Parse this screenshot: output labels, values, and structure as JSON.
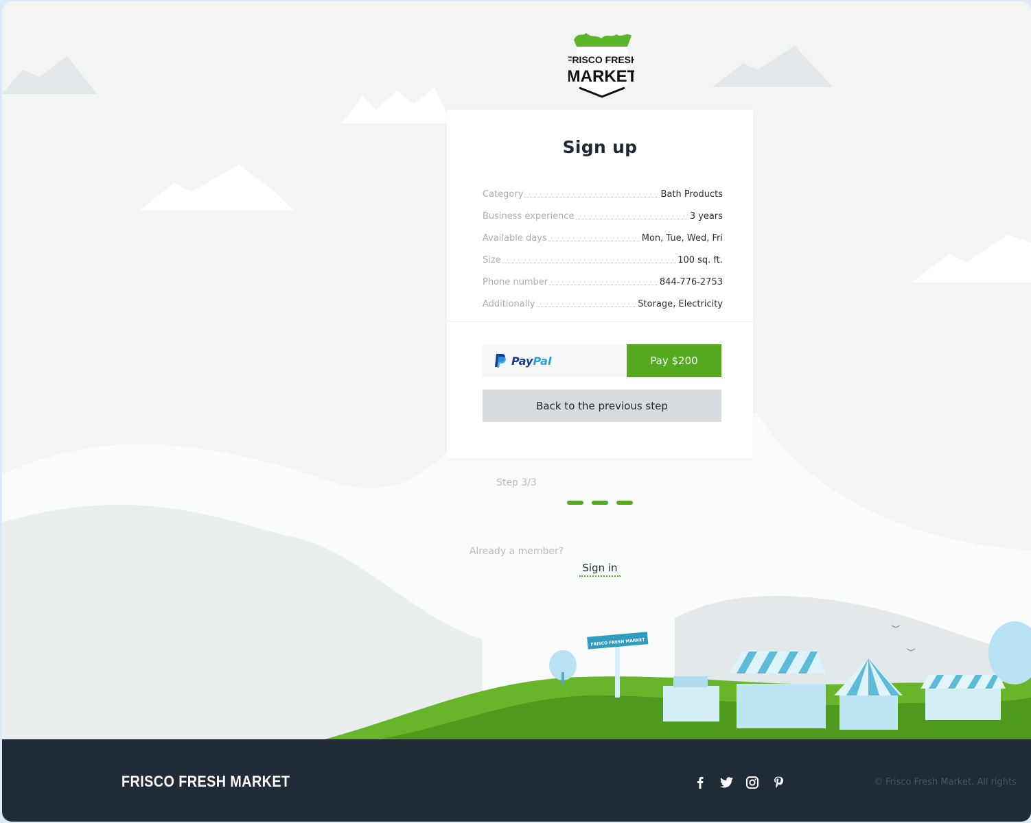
{
  "logo": {
    "line1": "FRISCO FRESH",
    "line2": "MARKET"
  },
  "card": {
    "title": "Sign up",
    "rows": [
      {
        "label": "Category",
        "value": "Bath Products"
      },
      {
        "label": "Business experience",
        "value": "3 years"
      },
      {
        "label": "Available days",
        "value": "Mon, Tue, Wed, Fri"
      },
      {
        "label": "Size",
        "value": "100 sq. ft."
      },
      {
        "label": "Phone number",
        "value": "844-776-2753"
      },
      {
        "label": "Additionally",
        "value": "Storage, Electricity"
      }
    ],
    "paypal_a": "Pay",
    "paypal_b": "Pal",
    "pay_button": "Pay $200",
    "back_button": "Back to the previous step"
  },
  "steps": {
    "label": "Step 3/3",
    "current": 3,
    "total": 3
  },
  "member": {
    "question": "Already a member?",
    "link": "Sign in"
  },
  "scene": {
    "sign_text": "FRISCO FRESH MARKET"
  },
  "footer": {
    "brand": "FRISCO FRESH MARKET",
    "social": [
      "facebook-icon",
      "twitter-icon",
      "instagram-icon",
      "pinterest-icon"
    ],
    "copyright": "© Frisco Fresh Market. All rights"
  },
  "colors": {
    "accent": "#54a91f",
    "footer_bg": "#212a37"
  }
}
